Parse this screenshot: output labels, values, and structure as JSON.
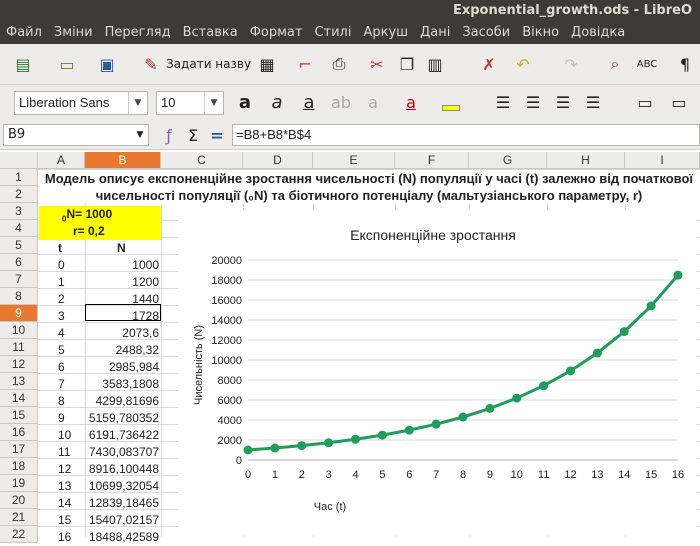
{
  "window": {
    "title": "Exponential_growth.ods - LibreO"
  },
  "menu": [
    "Файл",
    "Зміни",
    "Перегляд",
    "Вставка",
    "Формат",
    "Стилі",
    "Аркуш",
    "Дані",
    "Засоби",
    "Вікно",
    "Довідка"
  ],
  "toolbar": {
    "set_name_label": "Задати назву"
  },
  "format": {
    "font_name": "Liberation Sans",
    "font_size": "10"
  },
  "formula_bar": {
    "cell_ref": "B9",
    "formula": "=B8+B8*B$4"
  },
  "columns": [
    "A",
    "B",
    "C",
    "D",
    "E",
    "F",
    "G",
    "H",
    "I"
  ],
  "rows": [
    "1",
    "2",
    "3",
    "4",
    "5",
    "6",
    "7",
    "8",
    "9",
    "10",
    "11",
    "12",
    "13",
    "14",
    "15",
    "16",
    "17",
    "18",
    "19",
    "20",
    "21",
    "22"
  ],
  "sheet": {
    "title_line1": "Модель описує експоненційне зростання чисельності (N) популяції у часі (t) залежно від початкової",
    "title_line2": "чисельності популяції (₀N) та біотичного потенціалу (мальтузіанського параметру, r)",
    "n0_sub": "0",
    "n0_label": "N= 1000",
    "r_label": "r= 0,2",
    "header_t": "t",
    "header_n": "N",
    "t_values": [
      "0",
      "1",
      "2",
      "3",
      "4",
      "5",
      "6",
      "7",
      "8",
      "9",
      "10",
      "11",
      "12",
      "13",
      "14",
      "15",
      "16"
    ],
    "n_values": [
      "1000",
      "1200",
      "1440",
      "1728",
      "2073,6",
      "2488,32",
      "2985,984",
      "3583,1808",
      "4299,81696",
      "5159,780352",
      "6191,736422",
      "7430,083707",
      "8916,100448",
      "10699,32054",
      "12839,18465",
      "15407,02157",
      "18488,42589"
    ]
  },
  "chart_data": {
    "type": "line",
    "title": "Експоненційне зростання",
    "xlabel": "Час (t)",
    "ylabel": "Чисельність (N)",
    "x": [
      0,
      1,
      2,
      3,
      4,
      5,
      6,
      7,
      8,
      9,
      10,
      11,
      12,
      13,
      14,
      15,
      16
    ],
    "series": [
      {
        "values": [
          1000,
          1200,
          1440,
          1728,
          2073.6,
          2488.32,
          2985.984,
          3583.1808,
          4299.81696,
          5159.780352,
          6191.736422,
          7430.083707,
          8916.100448,
          10699.32054,
          12839.18465,
          15407.02157,
          18488.42589
        ]
      }
    ],
    "ylim": [
      0,
      20000
    ],
    "yticks": [
      0,
      2000,
      4000,
      6000,
      8000,
      10000,
      12000,
      14000,
      16000,
      18000,
      20000
    ],
    "grid": true,
    "color": "#1e9e59"
  }
}
